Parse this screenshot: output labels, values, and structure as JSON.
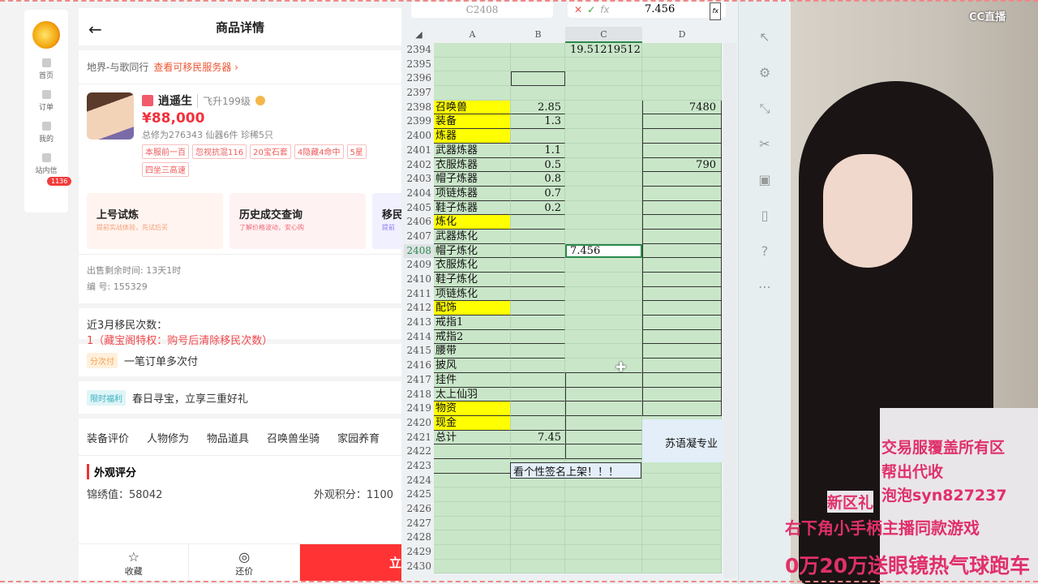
{
  "sidebar": {
    "items": [
      {
        "label": "首页"
      },
      {
        "label": "订单"
      },
      {
        "label": "我的"
      },
      {
        "label": "站内信"
      }
    ],
    "badge": "1136"
  },
  "header": {
    "title": "商品详情"
  },
  "server": {
    "name": "地界-与歌同行",
    "link": "查看可移民服务器 ›"
  },
  "product": {
    "name": "逍遥生",
    "level": "飞升199级",
    "price": "¥88,000",
    "stats": "总修为276343  仙器6件  珍稀5只",
    "tags": [
      "本服前一百",
      "忽视抗混116",
      "20宝石套",
      "4隐藏4命中",
      "5星",
      "四坐三高速"
    ]
  },
  "cards": [
    {
      "title": "上号试炼",
      "sub": "提前实战体验，先试后买",
      "color": "#f5a07a",
      "bg": "#fff4ef"
    },
    {
      "title": "历史成交查询",
      "sub": "了解价格波动，安心购",
      "color": "#f06a7a",
      "bg": "#fff2f3"
    },
    {
      "title": "移民",
      "sub": "提前",
      "color": "#8a7af0",
      "bg": "#f1f0ff"
    }
  ],
  "info": {
    "remaining": "出售剩余时间: 13天1时",
    "id": "编 号: 155329"
  },
  "migration": {
    "label": "近3月移民次数：",
    "value": "1（藏宝阁特权：购号后清除移民次数）"
  },
  "promos": [
    {
      "pill": "分次付",
      "text": "一笔订单多次付"
    },
    {
      "pill": "限时福利",
      "text": "春日寻宝，立享三重好礼"
    }
  ],
  "tabs": [
    "装备评价",
    "人物修为",
    "物品道具",
    "召唤兽坐骑",
    "家园养育"
  ],
  "appearance": {
    "title": "外观评分",
    "left": "锦绣值：58042",
    "right": "外观积分：1100"
  },
  "bottom": {
    "fav": "收藏",
    "bargain": "还价",
    "buy": "立"
  },
  "excel": {
    "namebox": "C2408",
    "formula": "7.456",
    "columns": [
      "A",
      "B",
      "C",
      "D"
    ],
    "rows": [
      {
        "n": "2394",
        "c": "19.51219512"
      },
      {
        "n": "2395"
      },
      {
        "n": "2396",
        "bbox": true
      },
      {
        "n": "2397"
      },
      {
        "n": "2398",
        "a": "召唤兽",
        "y": true,
        "b": "2.85",
        "d": "7480"
      },
      {
        "n": "2399",
        "a": "装备",
        "y": true,
        "b": "1.3"
      },
      {
        "n": "2400",
        "a": "炼器",
        "y": true
      },
      {
        "n": "2401",
        "a": "武器炼器",
        "b": "1.1"
      },
      {
        "n": "2402",
        "a": "衣服炼器",
        "b": "0.5",
        "d": "790"
      },
      {
        "n": "2403",
        "a": "帽子炼器",
        "b": "0.8"
      },
      {
        "n": "2404",
        "a": "项链炼器",
        "b": "0.7"
      },
      {
        "n": "2405",
        "a": "鞋子炼器",
        "b": "0.2"
      },
      {
        "n": "2406",
        "a": "炼化",
        "y": true
      },
      {
        "n": "2407",
        "a": "武器炼化"
      },
      {
        "n": "2408",
        "a": "帽子炼化",
        "c": "7.456",
        "sel": true
      },
      {
        "n": "2409",
        "a": "衣服炼化"
      },
      {
        "n": "2410",
        "a": "鞋子炼化"
      },
      {
        "n": "2411",
        "a": "项链炼化"
      },
      {
        "n": "2412",
        "a": "配饰",
        "y": true
      },
      {
        "n": "2413",
        "a": "戒指1"
      },
      {
        "n": "2414",
        "a": "戒指2"
      },
      {
        "n": "2415",
        "a": "腰带"
      },
      {
        "n": "2416",
        "a": "披风"
      },
      {
        "n": "2417",
        "a": "挂件"
      },
      {
        "n": "2418",
        "a": "太上仙羽"
      },
      {
        "n": "2419",
        "a": "物资",
        "y": true
      },
      {
        "n": "2420",
        "a": "现金",
        "y": true
      },
      {
        "n": "2421",
        "a": "总计",
        "b": "7.45"
      },
      {
        "n": "2422"
      },
      {
        "n": "2423"
      },
      {
        "n": "2424"
      },
      {
        "n": "2425"
      },
      {
        "n": "2426"
      },
      {
        "n": "2427"
      },
      {
        "n": "2428"
      },
      {
        "n": "2429"
      },
      {
        "n": "2430"
      }
    ],
    "merged_note": "看个性签名上架！！！",
    "side_note": "苏语凝专业"
  },
  "stream": {
    "logo": "CC直播",
    "lines": [
      "交易服覆盖所有区",
      "帮出代收",
      "泡泡syn827237",
      "新区礼",
      "右下角小手柄主播同款游戏",
      "0万20万送眼镜热气球跑车"
    ]
  }
}
